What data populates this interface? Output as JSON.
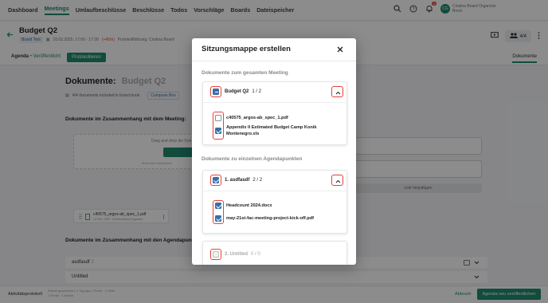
{
  "nav": {
    "items": [
      "Dashboard",
      "Meetings",
      "Umlaufbeschlüsse",
      "Beschlüsse",
      "Todos",
      "Vorschläge",
      "Boards",
      "Dateispeicher"
    ],
    "active_index": 1,
    "notification_count": "4",
    "avatar_initials": "CG",
    "user_name": "Cristina Board Organizer",
    "user_sub": "Brent"
  },
  "meeting": {
    "title": "Budget Q2",
    "board_tag": "Board Test",
    "datetime": "10.02.2025, 17:00 - 17:30",
    "warning": "(+45m)",
    "protocol": "Protokollführung: Cristina Board",
    "people_count": "4/4"
  },
  "tabs": {
    "agenda": "Agenda",
    "agenda_sub": "• Veröffentlicht",
    "publish": "Protokollieren",
    "documents": "Dokumente"
  },
  "page": {
    "heading": "Dokumente:",
    "heading_sub": "Budget Q2",
    "docs_info": "4/4   documents included in board book",
    "compose_link": "Compose Boo",
    "section_meeting": "Dokumente im Zusammenhang mit dem Meeting:",
    "dropzone_text": "Drag and drop die Dok",
    "dropzone_small": "Maximale Dateigröße",
    "add_link": "Link hinzufügen",
    "file_name": "c40575_argos-ab_spec_1.pdf",
    "file_sub": "12 Feb. 2025 · Cristina Board Organizer",
    "section_agenda": "Dokumente im Zusammenhang mit den Agendapunkten",
    "agenda_rows": [
      {
        "label": "asdfasdf",
        "count": "2"
      },
      {
        "label": "Untitled",
        "count": ""
      }
    ]
  },
  "footer": {
    "log": "Aktivitätsprotokoll",
    "hint_1": "Zuletzt gespeichert: 1 Tag ago   1 Punkt · 1 Seite",
    "hint_2": "1 Punkt · 1 Minute",
    "abort": "Abbruch",
    "publish_new": "Agenda neu veröffentlichen"
  },
  "modal": {
    "title": "Sitzungsmappe erstellen",
    "group_meeting_heading": "Dokumente zum gesamten Meeting",
    "group_agenda_heading": "Dokumente zu einzelnen Agendapunkten",
    "meeting_card": {
      "label": "Budget Q2",
      "count": "1 / 2",
      "state": "indeterminate",
      "docs": [
        {
          "name": "c40575_argos-ab_spec_1.pdf",
          "checked": false
        },
        {
          "name": "Appendix II Estimated Budget Camp Konik Montenegro.xls",
          "checked": true
        }
      ]
    },
    "agenda_cards": [
      {
        "label": "1. asdfasdf",
        "count": "2 / 2",
        "state": "checked",
        "docs": [
          {
            "name": "Headcount 2024.docx",
            "checked": true
          },
          {
            "name": "may-21st-fac-meeting-project-kick-off.pdf",
            "checked": true
          }
        ]
      },
      {
        "label": "2. Untitled",
        "count": "0 / 0",
        "state": "disabled",
        "docs": []
      }
    ]
  },
  "colors": {
    "brand": "#1f8a70",
    "checkbox": "#3a6ea8",
    "highlight": "#e3423b"
  }
}
